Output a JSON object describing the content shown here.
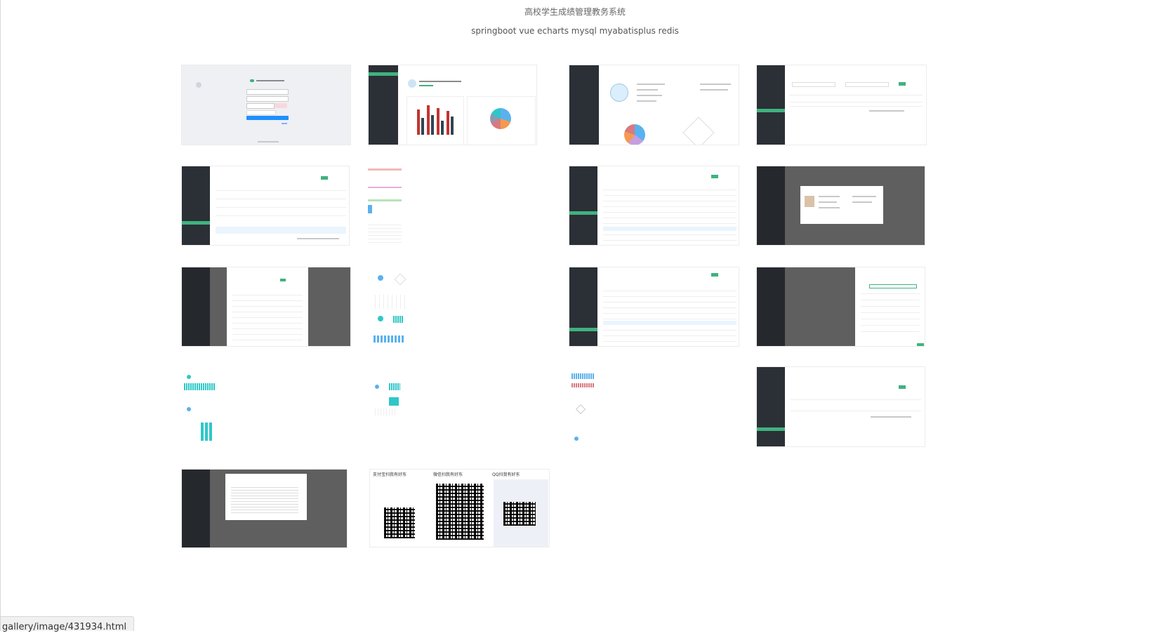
{
  "header": {
    "title": "高校学生成绩管理教务系统",
    "subtitle": "springboot vue echarts mysql myabatisplus redis"
  },
  "status_bar": {
    "url": "gallery/image/431934.html"
  },
  "accent_color": "#3fb27f",
  "sidebar_color": "#2b2f36",
  "thumbnails": [
    {
      "kind": "login"
    },
    {
      "kind": "dashboard-bar-pie"
    },
    {
      "kind": "profile-pie-radar"
    },
    {
      "kind": "table-small"
    },
    {
      "kind": "table-medium"
    },
    {
      "kind": "long-table-strip"
    },
    {
      "kind": "table-large"
    },
    {
      "kind": "profile-modal"
    },
    {
      "kind": "score-modal"
    },
    {
      "kind": "charts-strip"
    },
    {
      "kind": "table-large"
    },
    {
      "kind": "side-drawer-form"
    },
    {
      "kind": "charts-strip"
    },
    {
      "kind": "charts-strip"
    },
    {
      "kind": "charts-strip"
    },
    {
      "kind": "table-small"
    },
    {
      "kind": "text-modal"
    },
    {
      "kind": "donation-qr"
    }
  ],
  "donation": {
    "alipay_label": "支付宝扫我有好东",
    "wechat_label": "微信扫我有好东",
    "qq_label": "QQ扫我有好东"
  }
}
